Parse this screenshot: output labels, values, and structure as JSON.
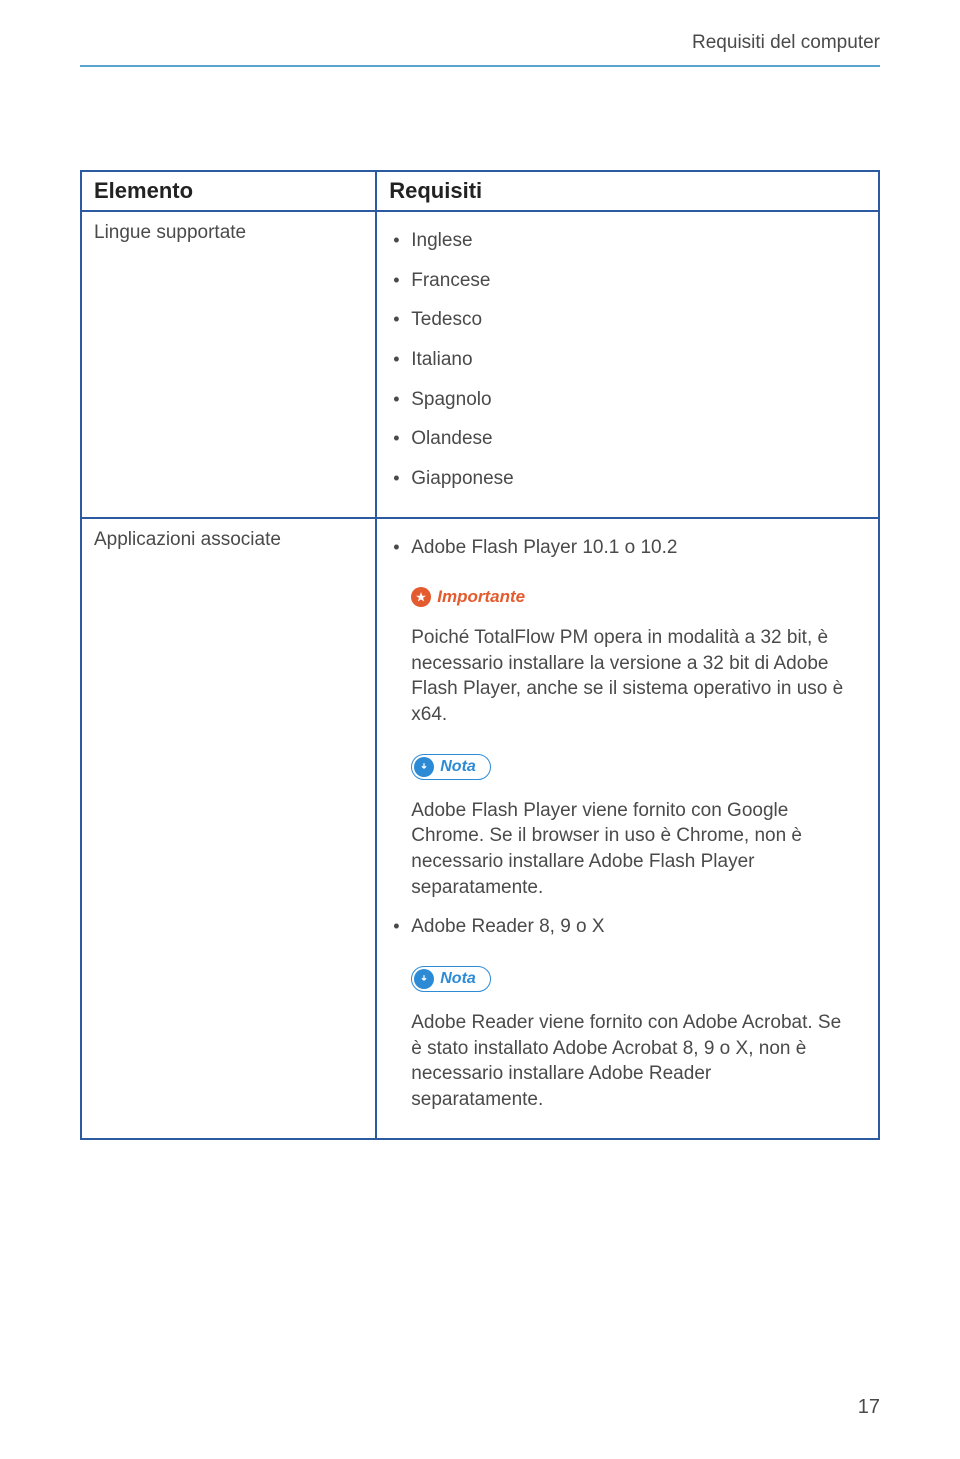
{
  "header": {
    "title": "Requisiti del computer"
  },
  "table": {
    "col1": "Elemento",
    "col2": "Requisiti",
    "rows": [
      {
        "element": "Lingue supportate",
        "items": [
          "Inglese",
          "Francese",
          "Tedesco",
          "Italiano",
          "Spagnolo",
          "Olandese",
          "Giapponese"
        ]
      },
      {
        "element": "Applicazioni associate",
        "item1": "Adobe Flash Player 10.1 o 10.2",
        "importante_label": "Importante",
        "importante_text": "Poiché TotalFlow PM opera in modalità a 32 bit, è necessario installare la versione a 32 bit di Adobe Flash Player, anche se il sistema operativo in uso è x64.",
        "nota1_label": "Nota",
        "nota1_text": "Adobe Flash Player viene fornito con Google Chrome. Se il browser in uso è Chrome, non è necessario installare Adobe Flash Player separatamente.",
        "item2": "Adobe Reader 8, 9 o X",
        "nota2_label": "Nota",
        "nota2_text": "Adobe Reader viene fornito con Adobe Acrobat. Se è stato installato Adobe Acrobat 8, 9 o X, non è necessario installare Adobe Reader separatamente."
      }
    ]
  },
  "page_number": "17"
}
